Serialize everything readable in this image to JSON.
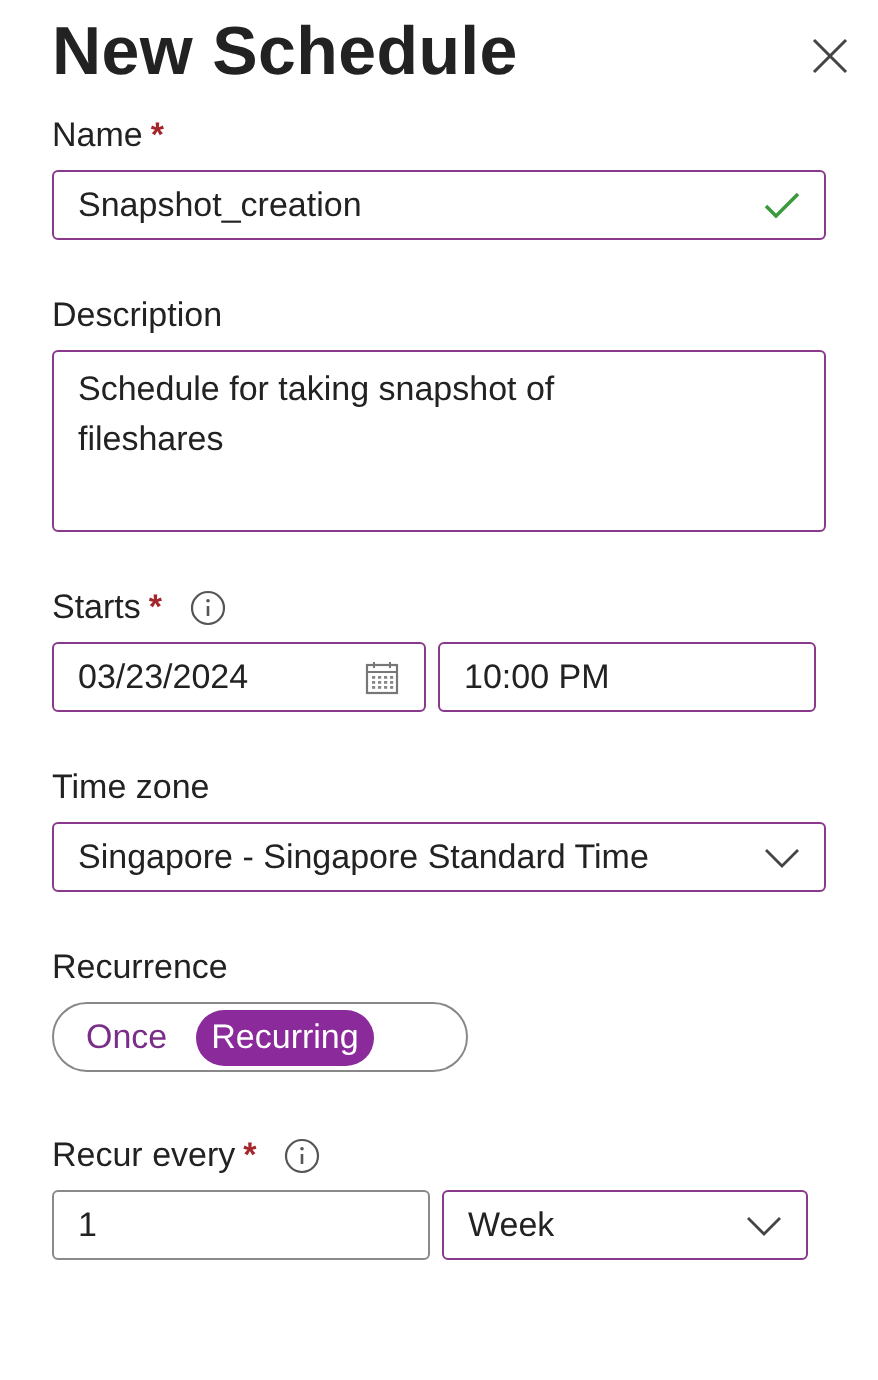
{
  "title": "New Schedule",
  "name": {
    "label": "Name",
    "required": "*",
    "value": "Snapshot_creation",
    "valid": true
  },
  "description": {
    "label": "Description",
    "value": "Schedule for taking snapshot of fileshares"
  },
  "starts": {
    "label": "Starts",
    "required": "*",
    "info": true,
    "date": "03/23/2024",
    "time": "10:00 PM"
  },
  "time_zone": {
    "label": "Time zone",
    "value": "Singapore - Singapore Standard Time"
  },
  "recurrence": {
    "label": "Recurrence",
    "options": [
      {
        "label": "Once",
        "selected": false
      },
      {
        "label": "Recurring",
        "selected": true
      }
    ]
  },
  "recur_every": {
    "label": "Recur every",
    "required": "*",
    "info": true,
    "count": "1",
    "unit": "Week"
  }
}
